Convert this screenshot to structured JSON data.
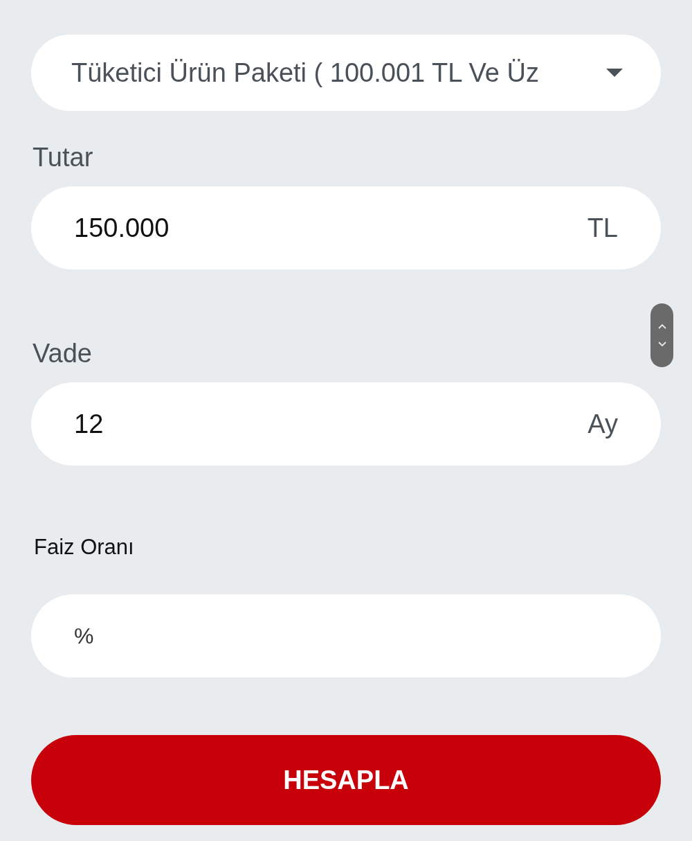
{
  "package_select": {
    "value": "Tüketici Ürün Paketi ( 100.001 TL Ve Üz"
  },
  "fields": [
    {
      "label": "Tutar",
      "value": "150.000",
      "unit": "TL",
      "kind": "large"
    },
    {
      "label": "Vade",
      "value": "12",
      "unit": "Ay",
      "kind": "large"
    },
    {
      "label": "Faiz Oranı",
      "placeholder": "%",
      "kind": "small"
    }
  ],
  "submit_button": {
    "label": "HESAPLA"
  }
}
